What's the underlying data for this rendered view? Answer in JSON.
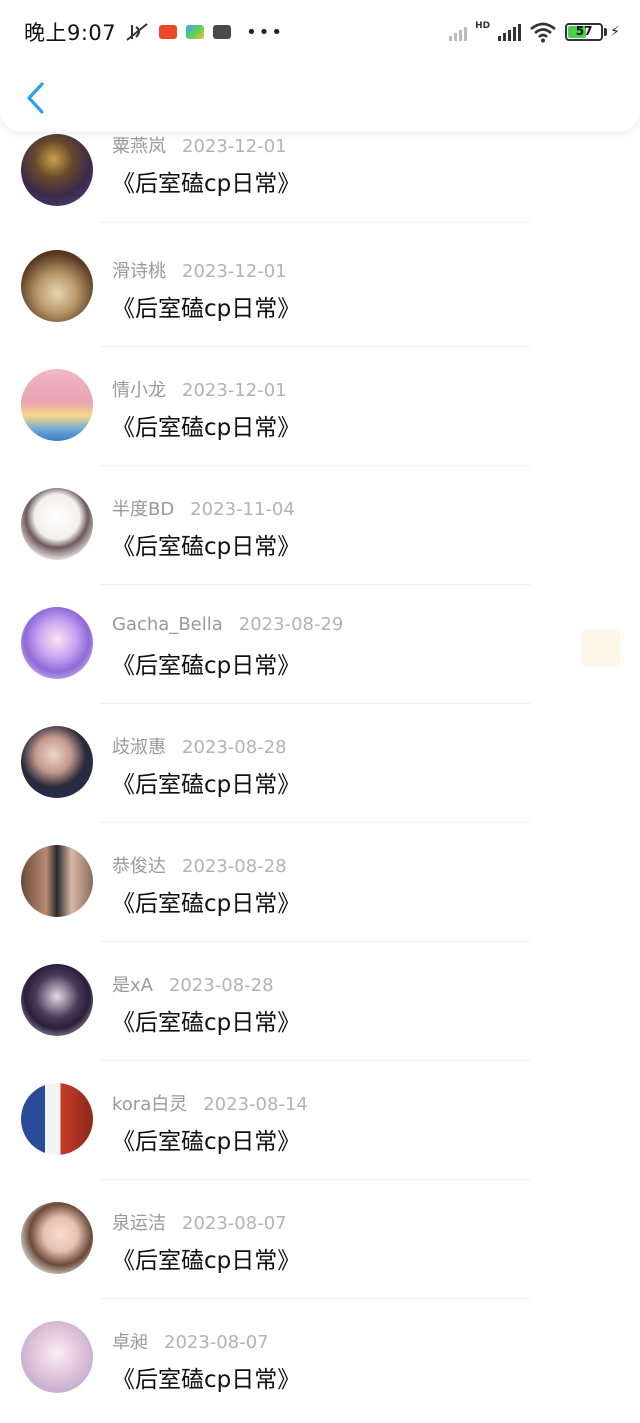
{
  "status_bar": {
    "time": "晚上9:07",
    "battery": "57",
    "network": "HD"
  },
  "nav": {
    "back_icon": "chevron-left-icon",
    "accent": "#2aa4e8"
  },
  "items": [
    {
      "author": "粟燕岚",
      "date": "2023-12-01",
      "title": "《后室磕cp日常》"
    },
    {
      "author": "滑诗桃",
      "date": "2023-12-01",
      "title": "《后室磕cp日常》"
    },
    {
      "author": "情小龙",
      "date": "2023-12-01",
      "title": "《后室磕cp日常》"
    },
    {
      "author": "半度BD",
      "date": "2023-11-04",
      "title": "《后室磕cp日常》"
    },
    {
      "author": "Gacha_Bella",
      "date": "2023-08-29",
      "title": "《后室磕cp日常》"
    },
    {
      "author": "歧淑惠",
      "date": "2023-08-28",
      "title": "《后室磕cp日常》"
    },
    {
      "author": "恭俊达",
      "date": "2023-08-28",
      "title": "《后室磕cp日常》"
    },
    {
      "author": "是xA",
      "date": "2023-08-28",
      "title": "《后室磕cp日常》"
    },
    {
      "author": "kora白灵",
      "date": "2023-08-14",
      "title": "《后室磕cp日常》"
    },
    {
      "author": "泉运洁",
      "date": "2023-08-07",
      "title": "《后室磕cp日常》"
    },
    {
      "author": "卓昶",
      "date": "2023-08-07",
      "title": "《后室磕cp日常》"
    }
  ]
}
